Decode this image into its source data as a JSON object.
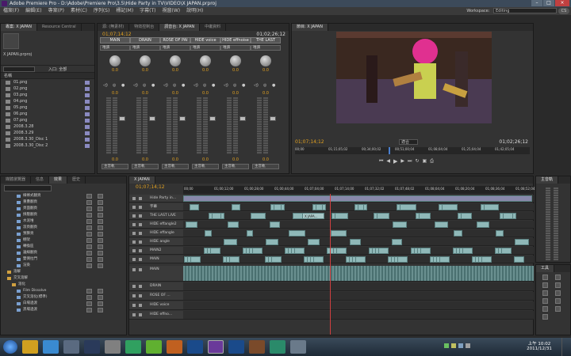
{
  "window": {
    "title": "Adobe Premiere Pro - D:\\Adobe\\Premiere Pro\\3.5\\Hide Party in TV\\VIDEO\\X JAPAN.prproj"
  },
  "menu": [
    "檔案(F)",
    "編輯(E)",
    "專案(P)",
    "素材(C)",
    "序列(S)",
    "標記(M)",
    "字幕(T)",
    "視窗(W)",
    "說明(H)"
  ],
  "workspace": {
    "label": "Workspace:",
    "value": "Editing",
    "cs_label": "CS"
  },
  "project_panel": {
    "tabs": [
      "專案: X JAPAN",
      "Resource Central"
    ],
    "name_item": "X JAPAN.prproj",
    "in_label": "入口: 全部",
    "column_name": "名稱",
    "items": [
      "01.png",
      "02.png",
      "03.png",
      "04.png",
      "05.png",
      "06.png",
      "07.png",
      "2008.3.28",
      "2008.3.29",
      "2008.3.30_Disc 1",
      "2008.3.30_Disc 2"
    ]
  },
  "mixer": {
    "tabs": [
      "源: (無素材)",
      "特效控制台",
      "調音台: X JAPAN",
      "中繼資料"
    ],
    "timecode": "01;07;14;12",
    "timecode_right": "01;02;26;12",
    "channels": [
      {
        "name": "MAIN",
        "mode": "唯讀",
        "value": "0.0",
        "meter_top": "0.0",
        "out": "主音軌"
      },
      {
        "name": "DRAIN",
        "mode": "唯讀",
        "value": "0.0",
        "meter_top": "0.0",
        "out": "主音軌"
      },
      {
        "name": "ROSE OF PAI",
        "mode": "唯讀",
        "value": "0.0",
        "meter_top": "0.0",
        "out": "主音軌"
      },
      {
        "name": "HIDE voice",
        "mode": "唯讀",
        "value": "0.0",
        "meter_top": "0.0",
        "out": "主音軌"
      },
      {
        "name": "HIDE effnoise",
        "mode": "唯讀",
        "value": "0.0",
        "meter_top": "0.0",
        "out": "主音軌"
      },
      {
        "name": "THE LAST",
        "mode": "唯讀",
        "value": "0.0",
        "meter_top": "0.0",
        "out": "主音軌"
      }
    ]
  },
  "program_monitor": {
    "tab": "節目: X JAPAN",
    "timecode_left": "01;07;14;12",
    "timecode_right": "01;02;26;12",
    "fit_label": "適合",
    "ruler_labels": [
      "00;00",
      "01;15;05;02",
      "00;34;00;02",
      "00;51;00;04",
      "01;08;04;04",
      "01;25;04;04",
      "01;42;05;04"
    ]
  },
  "effects_panel": {
    "tabs": [
      "媒體瀏覽器",
      "信息",
      "效果",
      "歷史"
    ],
    "items": [
      "線條式翻頁",
      "重疊翻頁",
      "頁面翻頁",
      "擠壓翻頁",
      "水泥堆",
      "滾頁翻頁",
      "預算頁",
      "棚架",
      "轉換區",
      "邊線翻頁",
      "雙側拉門",
      "渲染"
    ],
    "groups": [
      "溶解",
      "交叉溶解"
    ],
    "sub_label": "溶化",
    "items2": [
      "Film Dissolve",
      "交叉溶化(標準)",
      "白場過渡",
      "黑場過渡"
    ]
  },
  "timeline": {
    "tab": "X JAPAN",
    "timecode": "01;07;14;12",
    "ruler_labels": [
      "00;00",
      "01;00;12;00",
      "01;00;28;00",
      "01;00;44;00",
      "01;07;04;00",
      "01;07;14;00",
      "01;07;32;02",
      "01;07;48;02",
      "01;08;04;04",
      "01;08;20;04",
      "01;08;36;04",
      "01;08;52;04"
    ],
    "video_tracks": [
      "Hide Party in...",
      "字幕",
      "THE LAST LIVE",
      "HIDE effangle2",
      "HIDE effangle",
      "HIDE angle",
      "MAIN2",
      "MAIN"
    ],
    "audio_tracks": [
      "MAIN",
      "DRAIN",
      "ROSE OF ...",
      "HIDE voice",
      "HIDE effno..."
    ],
    "clip_label": "X JAPA..."
  },
  "audio_master": {
    "tab": "主音軌"
  },
  "tools_panel": {
    "tab": "工具"
  },
  "taskbar": {
    "time": "上午 10:02",
    "date": "2011/12/31"
  }
}
